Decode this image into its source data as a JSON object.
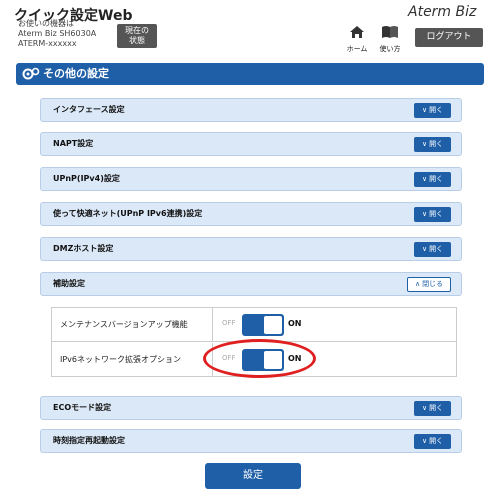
{
  "header": {
    "title": "クイック設定Web",
    "device_line_1": "お使いの機器は",
    "device_line_2": "Aterm Biz SH6030A",
    "device_line_3": "ATERM-xxxxxx",
    "status_button": "現在の\n状態",
    "brand": "Aterm Biz",
    "home_label": "ホーム",
    "guide_label": "使い方",
    "logout_label": "ログアウト"
  },
  "page": {
    "title": "その他の設定"
  },
  "sections": [
    {
      "label": "インタフェース設定",
      "button": "開く"
    },
    {
      "label": "NAPT設定",
      "button": "開く"
    },
    {
      "label": "UPnP(IPv4)設定",
      "button": "開く"
    },
    {
      "label": "使って快適ネット(UPnP IPv6連携)設定",
      "button": "開く"
    },
    {
      "label": "DMZホスト設定",
      "button": "開く"
    },
    {
      "label": "補助設定",
      "button": "閉じる"
    },
    {
      "label": "ECOモード設定",
      "button": "開く"
    },
    {
      "label": "時刻指定再起動設定",
      "button": "開く"
    }
  ],
  "aux_settings": [
    {
      "label": "メンテナンスバージョンアップ機能",
      "off": "OFF",
      "on": "ON",
      "value": "ON"
    },
    {
      "label": "IPv6ネットワーク拡張オプション",
      "off": "OFF",
      "on": "ON",
      "value": "ON"
    }
  ],
  "submit_label": "設定",
  "colors": {
    "accent": "#1f5fa8",
    "section_bg": "#dbe8f7",
    "highlight": "#e02020"
  }
}
